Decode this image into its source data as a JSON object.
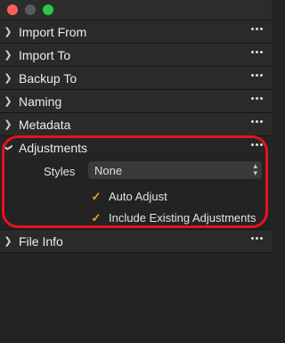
{
  "window": {
    "traffic_lights": [
      {
        "name": "close",
        "color": "#ff5f57"
      },
      {
        "name": "minimize",
        "color": "#5a5a5a"
      },
      {
        "name": "zoom",
        "color": "#2ac840"
      }
    ]
  },
  "panels": [
    {
      "title": "Import From",
      "expanded": false
    },
    {
      "title": "Import To",
      "expanded": false
    },
    {
      "title": "Backup To",
      "expanded": false
    },
    {
      "title": "Naming",
      "expanded": false
    },
    {
      "title": "Metadata",
      "expanded": false
    },
    {
      "title": "Adjustments",
      "expanded": true
    },
    {
      "title": "File Info",
      "expanded": false
    }
  ],
  "adjustments": {
    "styles_label": "Styles",
    "styles_value": "None",
    "auto_adjust_label": "Auto Adjust",
    "auto_adjust_checked": true,
    "include_existing_label": "Include Existing Adjustments",
    "include_existing_checked": true
  },
  "colors": {
    "highlight": "#e8121a",
    "checkmark": "#f0a030"
  }
}
